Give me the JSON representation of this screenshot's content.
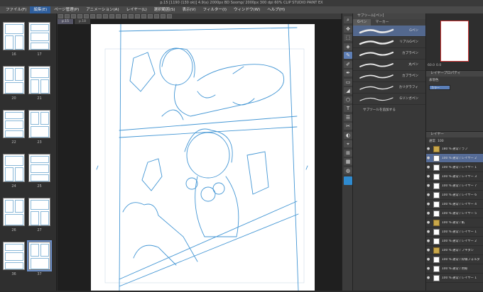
{
  "title": "p.15 [1190 (130 ok)] 4.9(a) 2000px  BD Soomp/ 2000px  300 dpi  60%  CLIP STUDIO PAINT EX",
  "menu": [
    "ファイル(F)",
    "編集(E)",
    "ページ管理(P)",
    "アニメーション(A)",
    "レイヤー(L)",
    "選択範囲(S)",
    "表示(V)",
    "フィルター(I)",
    "ウィンドウ(W)",
    "ヘルプ(H)"
  ],
  "menu_active_index": 1,
  "doc_tabs": [
    "p.15",
    "p.18"
  ],
  "page_numbers": [
    "16",
    "17",
    "20",
    "21",
    "22",
    "23",
    "24",
    "25",
    "26",
    "27",
    "36",
    "37"
  ],
  "subtool": {
    "header": "サブツール[ペン]",
    "tabs": [
      "Gペン",
      "マーカー"
    ],
    "brushes": [
      "Gペン",
      "リアルGペン",
      "カブラペン",
      "丸ペン",
      "カブラペン",
      "カリグラフィ",
      "Gリンガペン"
    ],
    "selected": 0,
    "add": "サブツールを追加する"
  },
  "navigator": {
    "zoom": "60.0",
    "angle": "0.0"
  },
  "property": {
    "header": "レイヤープロパティ",
    "effect": "表現色",
    "color_label": "カラー"
  },
  "layer": {
    "header": "レイヤー",
    "blend": "通常",
    "opacity": "100"
  },
  "layers": [
    {
      "name": "180 % 通常\nラフ",
      "folder": true,
      "sel": false
    },
    {
      "name": "100 % 通常\nレイヤー 2",
      "folder": false,
      "sel": true
    },
    {
      "name": "100 % 通常\nレイヤー 1",
      "folder": false,
      "sel": false
    },
    {
      "name": "100 % 通常\nレイヤー 3",
      "folder": false,
      "sel": false
    },
    {
      "name": "100 % 通常\nレイヤー 7",
      "folder": false,
      "sel": false
    },
    {
      "name": "100 % 通常\nレイヤー 6",
      "folder": false,
      "sel": false
    },
    {
      "name": "100 % 通常\nレイヤー 4",
      "folder": false,
      "sel": false
    },
    {
      "name": "100 % 通常\nレイヤー 5",
      "folder": false,
      "sel": false
    },
    {
      "name": "100 % 通常\n紙",
      "folder": true,
      "sel": false
    },
    {
      "name": "100 % 通常\nレイヤー 1",
      "folder": false,
      "sel": false
    },
    {
      "name": "100 % 通常\nレイヤー 2",
      "folder": false,
      "sel": false
    },
    {
      "name": "100 % 通常\nフキダシ",
      "folder": true,
      "sel": false
    },
    {
      "name": "100 % 通常\n枠線フォルダ",
      "folder": false,
      "sel": false
    },
    {
      "name": "100 % 通常\n用紙",
      "folder": false,
      "sel": false
    },
    {
      "name": "100 % 通常\nレイヤー 1",
      "folder": false,
      "sel": false
    }
  ],
  "colors": {
    "accent": "#2f5f9e",
    "sketch": "#2f8bd0",
    "select": "#556b96"
  }
}
